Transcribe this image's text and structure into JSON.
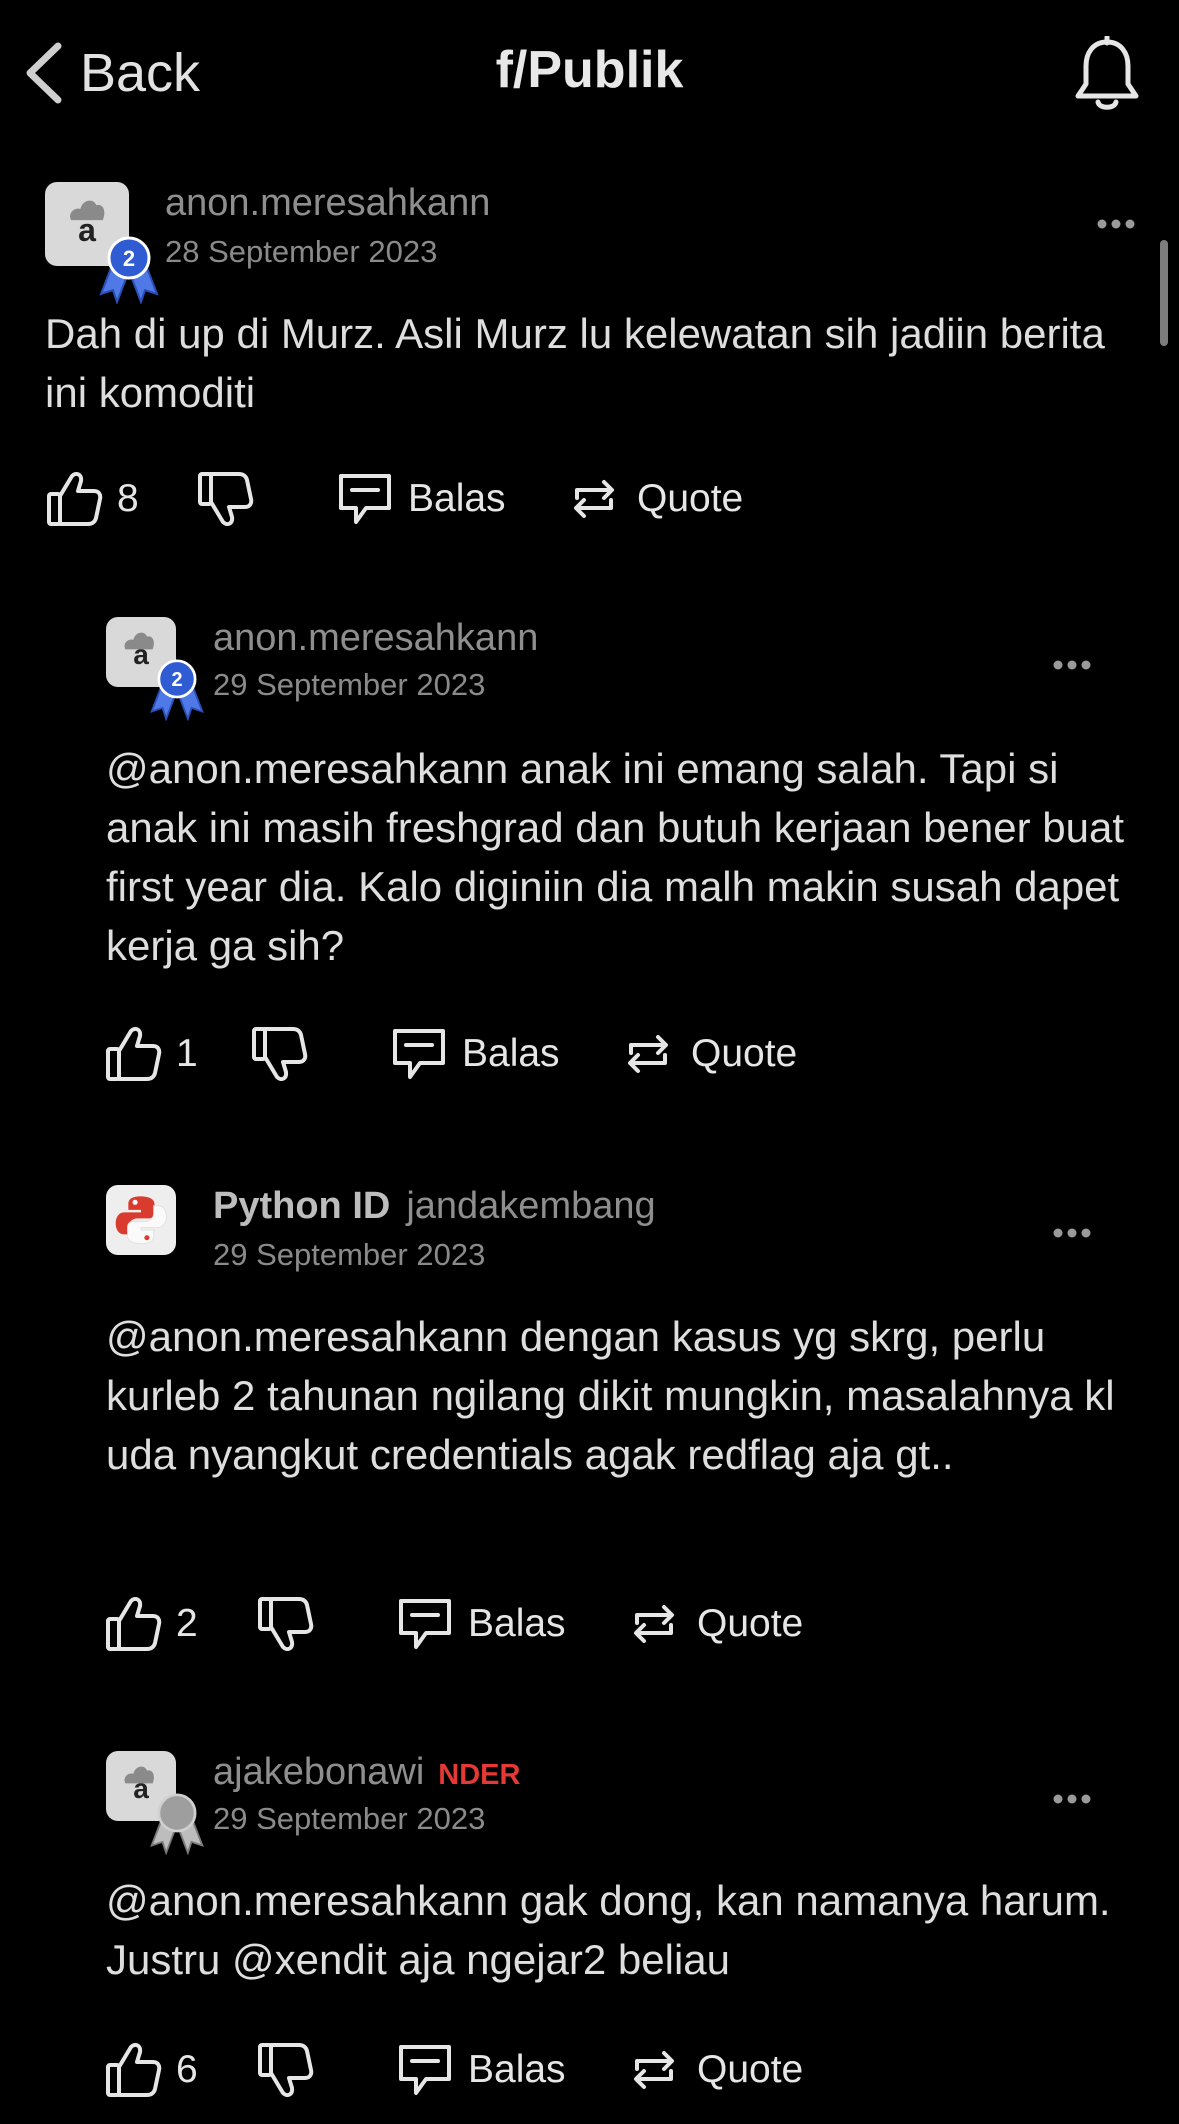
{
  "header": {
    "back_label": "Back",
    "title": "f/Publik"
  },
  "comments": [
    {
      "username": "anon.meresahkann",
      "date": "28 September 2023",
      "avatar_letter": "a",
      "medal_level": "2",
      "text": "Dah di up di Murz. Asli Murz lu kelewatan sih jadiin berita ini komoditi",
      "likes": "8",
      "reply_label": "Balas",
      "quote_label": "Quote"
    },
    {
      "username": "anon.meresahkann",
      "date": "29 September 2023",
      "avatar_letter": "a",
      "medal_level": "2",
      "text": "@anon.meresahkann anak ini emang salah. Tapi si anak ini masih freshgrad dan butuh kerjaan bener buat first year dia. Kalo diginiin dia malh makin susah dapet kerja ga sih?",
      "likes": "1",
      "reply_label": "Balas",
      "quote_label": "Quote"
    },
    {
      "community": "Python ID",
      "username": "jandakembang",
      "date": "29 September 2023",
      "text": "@anon.meresahkann dengan kasus yg skrg, perlu kurleb 2 tahunan ngilang dikit mungkin, masalahnya kl uda nyangkut credentials agak redflag aja gt..",
      "likes": "2",
      "reply_label": "Balas",
      "quote_label": "Quote"
    },
    {
      "username": "ajakebonawi",
      "badge": "NDER",
      "date": "29 September 2023",
      "avatar_letter": "a",
      "text": "@anon.meresahkann gak dong, kan namanya harum. Justru @xendit aja ngejar2 beliau",
      "likes": "6",
      "reply_label": "Balas",
      "quote_label": "Quote"
    }
  ],
  "colors": {
    "background": "#000000",
    "badge": "#e53935",
    "medal_blue": "#2f5bd3",
    "medal_silver": "#9e9e9e"
  },
  "icons": [
    "chevron-left-icon",
    "bell-icon",
    "thumbs-up-icon",
    "thumbs-down-icon",
    "reply-icon",
    "repeat-icon",
    "more-icon"
  ]
}
